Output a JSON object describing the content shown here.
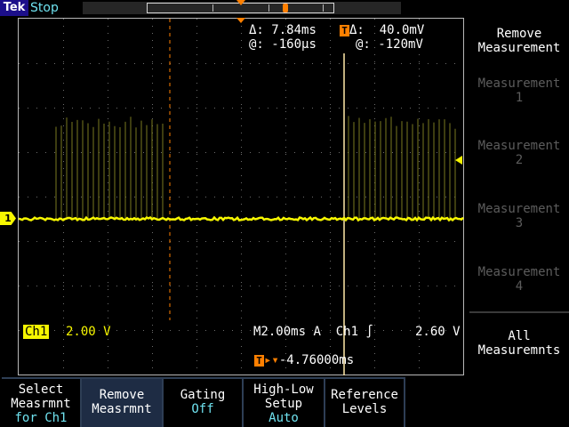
{
  "header": {
    "logo": "Tek",
    "run_state": "Stop"
  },
  "readouts": {
    "cursor_delta_time_label": "Δ:",
    "cursor_delta_time": "7.84ms",
    "cursor_at_time_label": "@:",
    "cursor_at_time": "-160µs",
    "cursor_delta_volt_label": "Δ:",
    "cursor_delta_volt": "40.0mV",
    "cursor_at_volt_label": "@:",
    "cursor_at_volt": "-120mV",
    "ch1_label": "Ch1",
    "ch1_scale": "2.00 V",
    "timebase": "M2.00ms",
    "trigger_mode": "A",
    "trigger_source": "Ch1",
    "trigger_slope_icon": "rising-edge-icon",
    "trigger_level": "2.60 V",
    "trigger_position": "-4.76000ms"
  },
  "channel_marker": "1",
  "side_menu": {
    "title_line1": "Remove",
    "title_line2": "Measurement",
    "items": [
      {
        "line1": "Measurement",
        "line2": "1"
      },
      {
        "line1": "Measurement",
        "line2": "2"
      },
      {
        "line1": "Measurement",
        "line2": "3"
      },
      {
        "line1": "Measurement",
        "line2": "4"
      }
    ],
    "all_line1": "All",
    "all_line2": "Measuremnts"
  },
  "bottom_menu": [
    {
      "line1": "Select",
      "line2": "Measrmnt",
      "line3": "for Ch1"
    },
    {
      "line1": "Remove",
      "line2": "Measrmnt",
      "line3": ""
    },
    {
      "line1": "Gating",
      "line2": "Off",
      "line3": ""
    },
    {
      "line1": "High-Low",
      "line2": "Setup",
      "line3": "Auto"
    },
    {
      "line1": "Reference",
      "line2": "Levels",
      "line3": ""
    }
  ],
  "colors": {
    "trace": "#f6f600",
    "accent": "#ff8000",
    "state": "#6fe2ef",
    "menu_bg": "#1e2c44"
  }
}
